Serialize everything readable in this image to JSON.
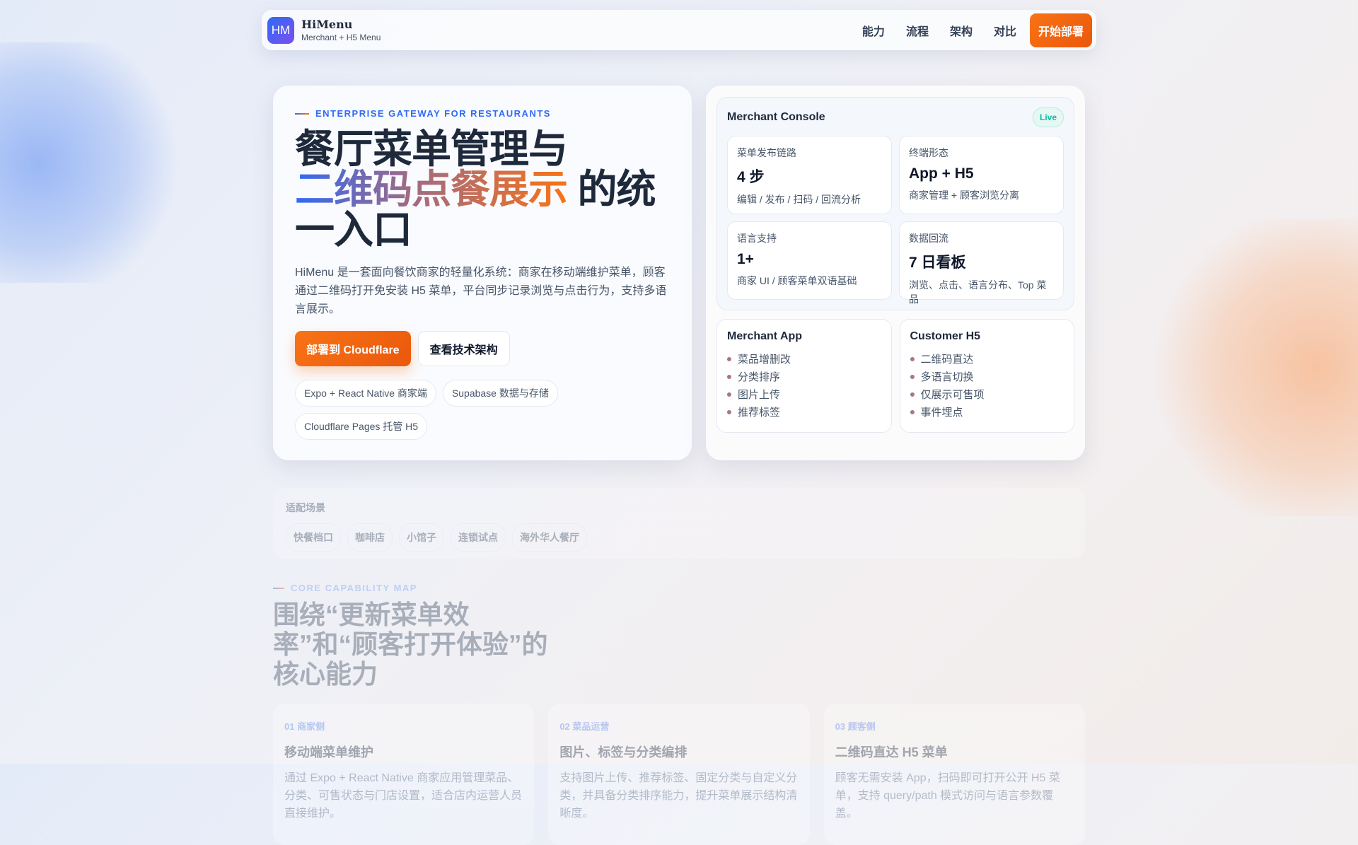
{
  "nav": {
    "logo": "HM",
    "title": "HiMenu",
    "subtitle": "Merchant + H5 Menu",
    "links": [
      "能力",
      "流程",
      "架构",
      "对比"
    ],
    "cta": "开始部署"
  },
  "hero": {
    "eyebrow": "ENTERPRISE GATEWAY FOR RESTAURANTS",
    "title_line1": "餐厅菜单管理与",
    "title_highlight": "二维码点餐展示",
    "title_rest": " 的统一入口",
    "description": "HiMenu 是一套面向餐饮商家的轻量化系统：商家在移动端维护菜单，顾客通过二维码打开免安装 H5 菜单，平台同步记录浏览与点击行为，支持多语言展示。",
    "primary_cta": "部署到 Cloudflare",
    "secondary_cta": "查看技术架构",
    "chips": [
      "Expo + React Native 商家端",
      "Supabase 数据与存储",
      "Cloudflare Pages 托管 H5"
    ]
  },
  "console": {
    "title": "Merchant Console",
    "badge": "Live",
    "stats": [
      {
        "label": "菜单发布链路",
        "value": "4 步",
        "desc": "编辑 / 发布 / 扫码 / 回流分析"
      },
      {
        "label": "终端形态",
        "value": "App + H5",
        "desc": "商家管理 + 顾客浏览分离"
      },
      {
        "label": "语言支持",
        "value": "1+",
        "desc": "商家 UI / 顾客菜单双语基础"
      },
      {
        "label": "数据回流",
        "value": "7 日看板",
        "desc": "浏览、点击、语言分布、Top 菜品"
      }
    ]
  },
  "merchant_app": {
    "title": "Merchant App",
    "items": [
      "菜品增删改",
      "分类排序",
      "图片上传",
      "推荐标签"
    ]
  },
  "customer_h5": {
    "title": "Customer H5",
    "items": [
      "二维码直达",
      "多语言切换",
      "仅展示可售项",
      "事件埋点"
    ]
  },
  "scenes": {
    "title": "适配场景",
    "items": [
      "快餐档口",
      "咖啡店",
      "小馆子",
      "连锁试点",
      "海外华人餐厅"
    ]
  },
  "capabilities": {
    "eyebrow": "CORE CAPABILITY MAP",
    "title": "围绕“更新菜单效率”和“顾客打开体验”的核心能力",
    "cards": [
      {
        "num": "01 商家侧",
        "title": "移动端菜单维护",
        "desc": "通过 Expo + React Native 商家应用管理菜品、分类、可售状态与门店设置，适合店内运营人员直接维护。"
      },
      {
        "num": "02 菜品运营",
        "title": "图片、标签与分类编排",
        "desc": "支持图片上传、推荐标签、固定分类与自定义分类，并具备分类排序能力，提升菜单展示结构清晰度。"
      },
      {
        "num": "03 顾客侧",
        "title": "二维码直达 H5 菜单",
        "desc": "顾客无需安装 App，扫码即可打开公开 H5 菜单，支持 query/path 模式访问与语言参数覆盖。"
      }
    ]
  }
}
